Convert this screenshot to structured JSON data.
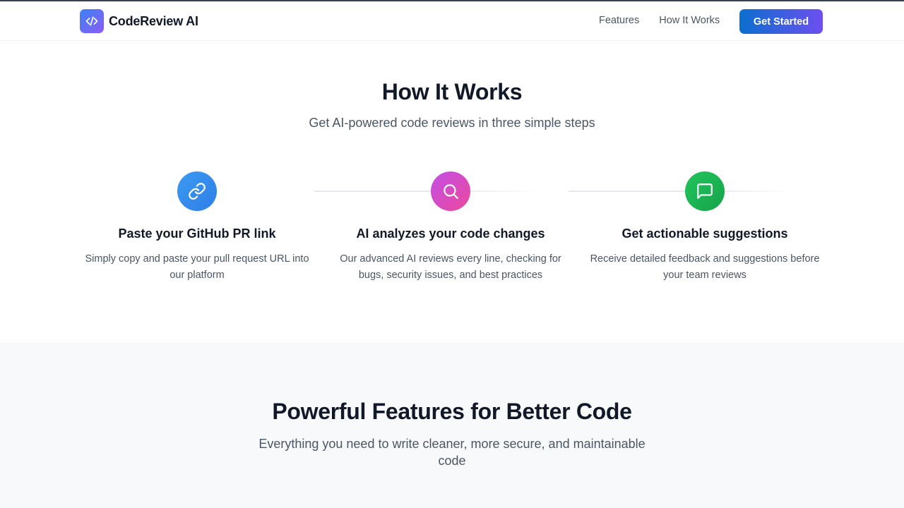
{
  "brand": {
    "name": "CodeReview AI",
    "logo_icon": "code-brackets-icon"
  },
  "nav": {
    "links": [
      "Features",
      "How It Works"
    ],
    "cta_label": "Get Started"
  },
  "how_it_works": {
    "title": "How It Works",
    "subtitle": "Get AI-powered code reviews in three simple steps",
    "steps": [
      {
        "icon": "link-icon",
        "color": "#3b82f6",
        "title": "Paste your GitHub PR link",
        "description": "Simply copy and paste your pull request URL into our platform"
      },
      {
        "icon": "search-icon",
        "color": "#d946ef",
        "title": "AI analyzes your code changes",
        "description": "Our advanced AI reviews every line, checking for bugs, security issues, and best practices"
      },
      {
        "icon": "chat-icon",
        "color": "#22c55e",
        "title": "Get actionable suggestions",
        "description": "Receive detailed feedback and suggestions before your team reviews"
      }
    ]
  },
  "features": {
    "title": "Powerful Features for Better Code",
    "subtitle": "Everything you need to write cleaner, more secure, and maintainable code"
  }
}
